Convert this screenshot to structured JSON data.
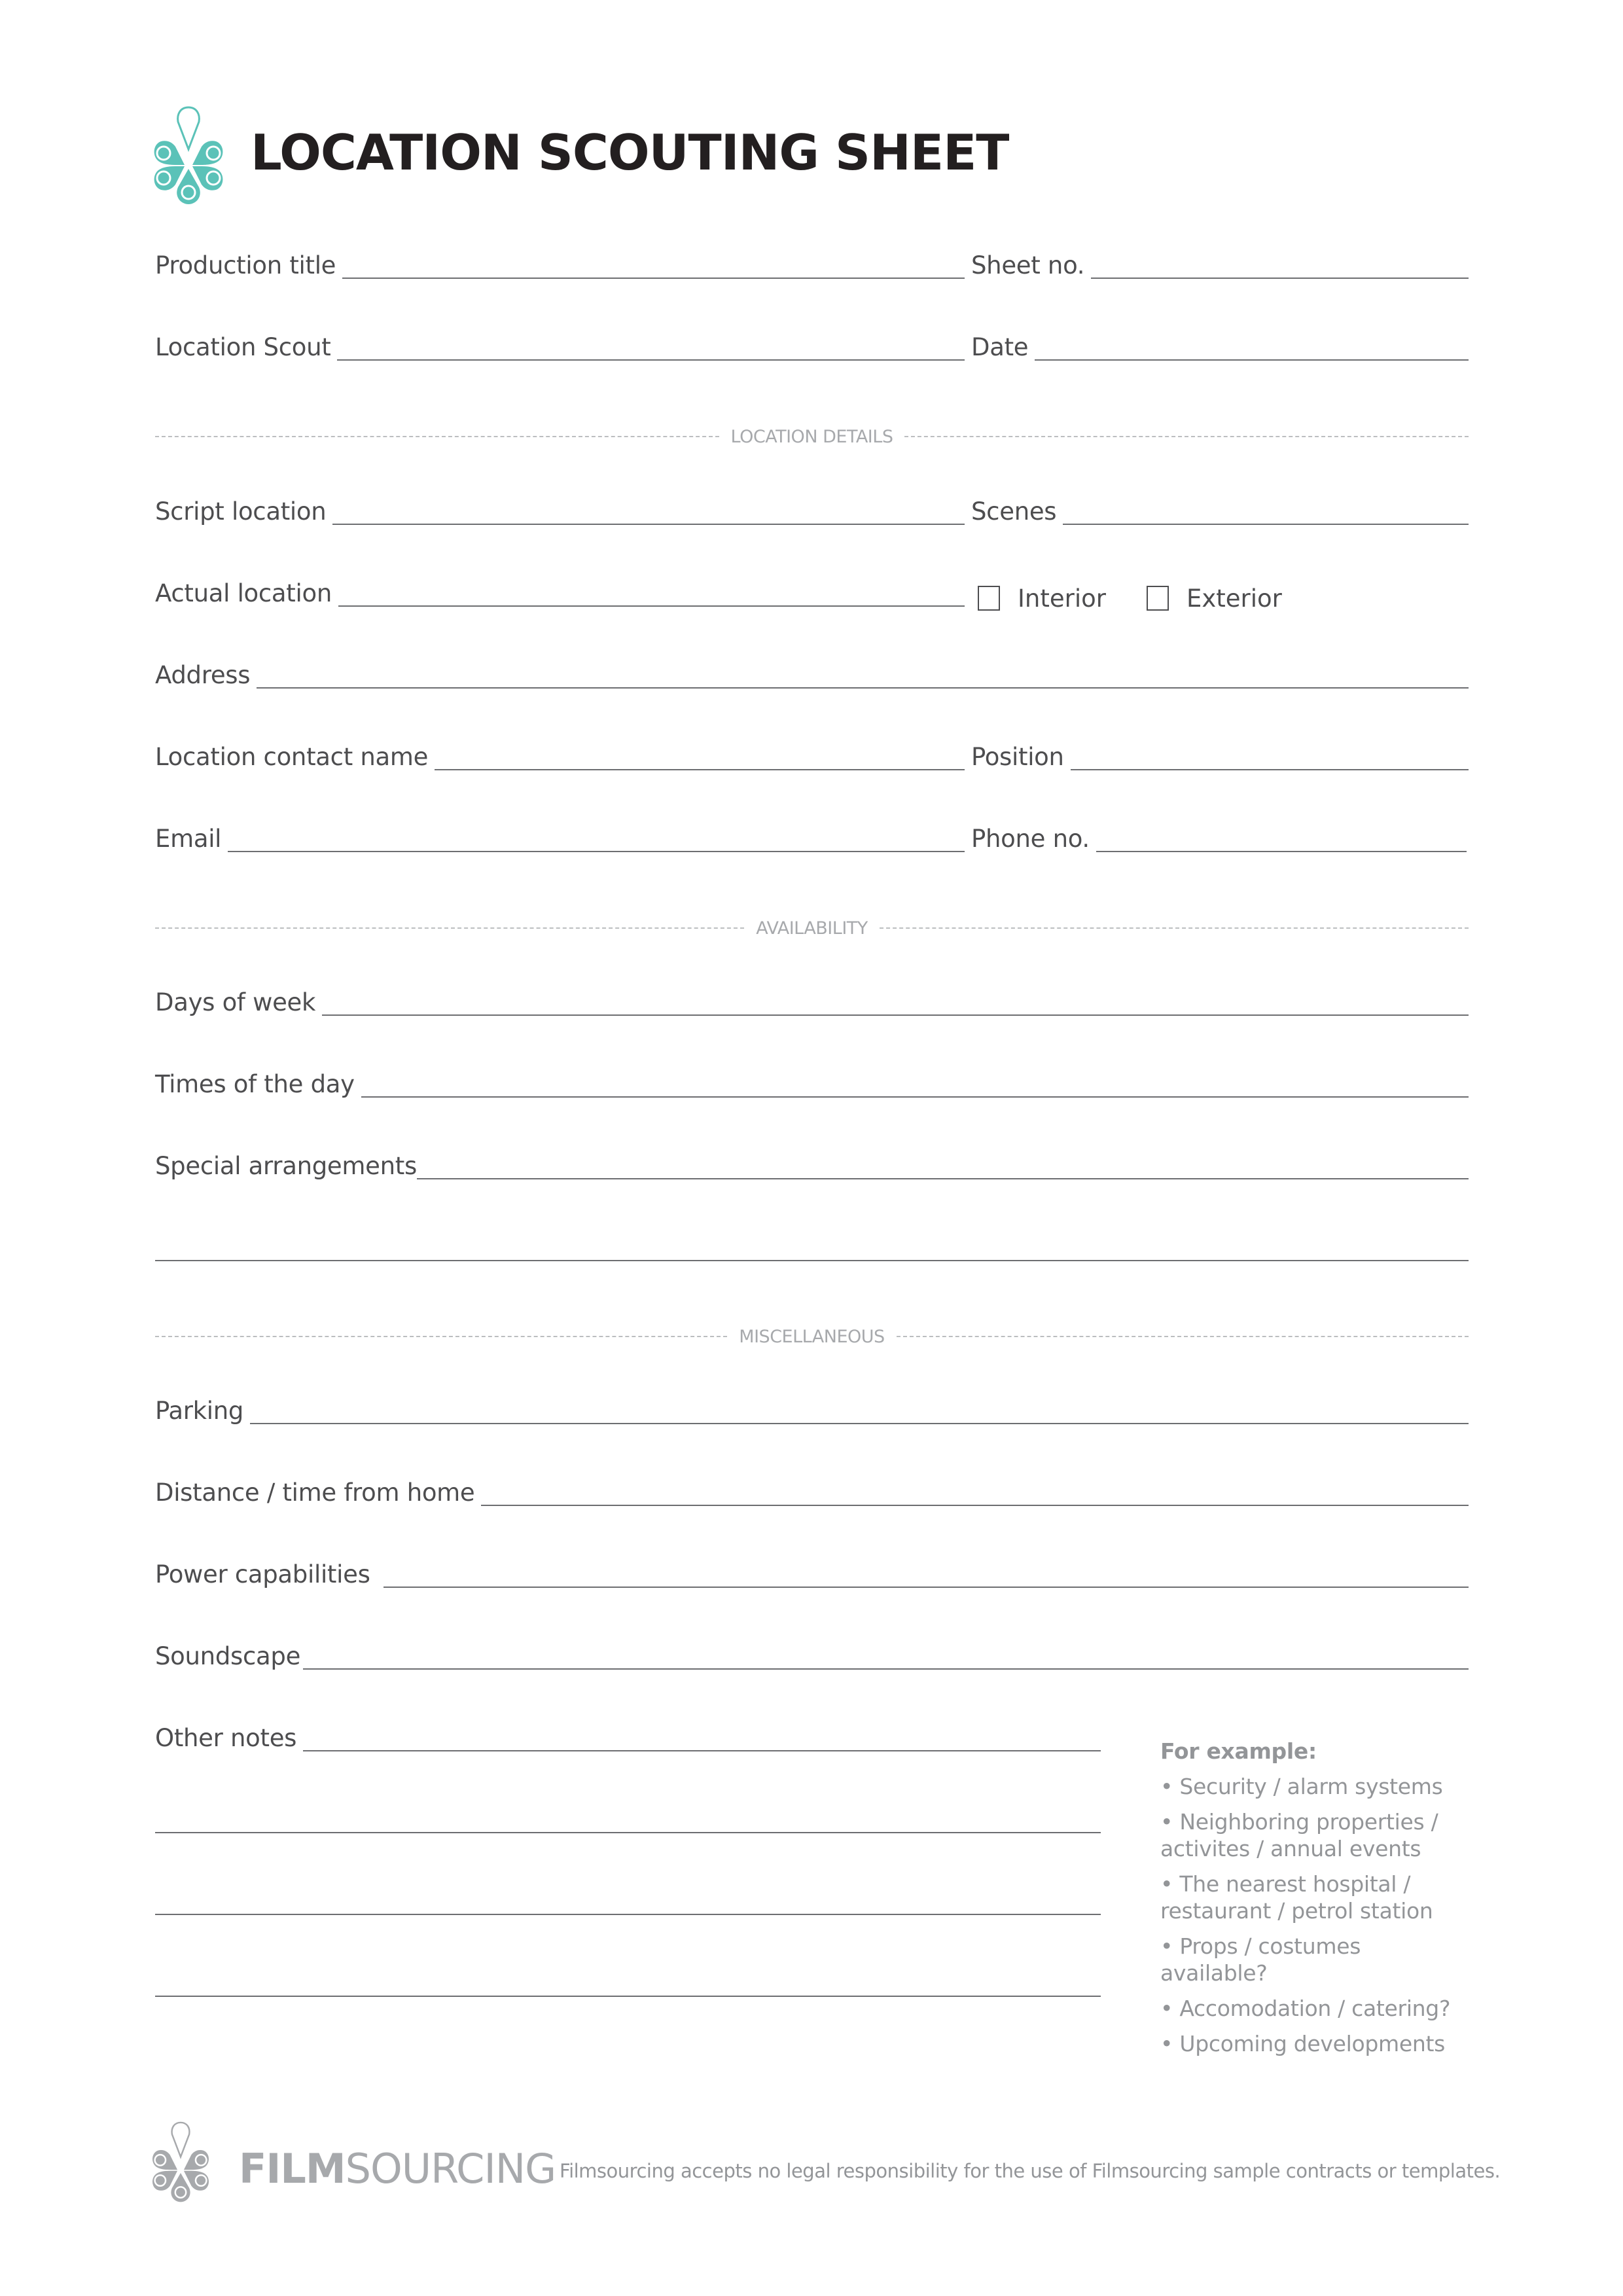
{
  "header": {
    "title": "LOCATION SCOUTING SHEET",
    "logo_icon": "filmsourcing-pin-flower-logo",
    "accent_color": "#5bc2b8"
  },
  "top_fields": {
    "production_title": "Production title",
    "sheet_no": "Sheet no.",
    "location_scout": "Location Scout",
    "date": "Date"
  },
  "sections": {
    "location_details": "LOCATION DETAILS",
    "availability": "AVAILABILITY",
    "miscellaneous": "MISCELLANEOUS"
  },
  "location_details": {
    "script_location": "Script location",
    "scenes": "Scenes",
    "actual_location": "Actual location",
    "interior": "Interior",
    "exterior": "Exterior",
    "interior_checked": false,
    "exterior_checked": false,
    "address": "Address",
    "contact_name": "Location contact name",
    "position": "Position",
    "email": "Email",
    "phone": "Phone no."
  },
  "availability": {
    "days_of_week": "Days of week",
    "times_of_day": "Times of the day",
    "special_arrangements": "Special arrangements"
  },
  "miscellaneous": {
    "parking": "Parking",
    "distance": "Distance / time from home",
    "power": "Power capabilities",
    "soundscape": "Soundscape",
    "other_notes": "Other notes"
  },
  "examples": {
    "heading": "For example:",
    "items": [
      "• Security / alarm systems",
      "• Neighboring properties / activites / annual events",
      "• The nearest hospital / restaurant / petrol station",
      "• Props / costumes available?",
      "• Accomodation / catering?",
      "• Upcoming developments"
    ]
  },
  "footer": {
    "brand_bold": "FILM",
    "brand_light": "SOURCING",
    "disclaimer": "Filmsourcing accepts no legal responsibility for the use of Filmsourcing sample contracts or templates.",
    "logo_color": "#a7a9ac"
  }
}
